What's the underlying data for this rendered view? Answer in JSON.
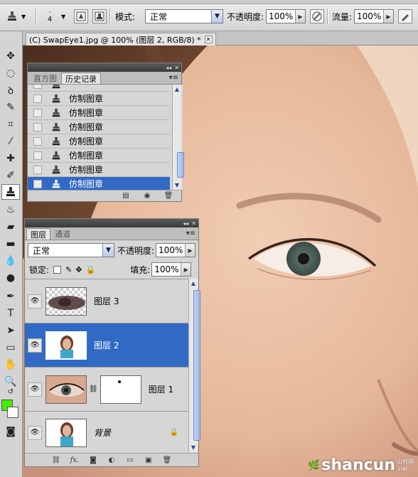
{
  "options_bar": {
    "brush_size": "4",
    "mode_label": "模式:",
    "mode_value": "正常",
    "opacity_label": "不透明度:",
    "opacity_value": "100%",
    "flow_label": "流量:",
    "flow_value": "100%"
  },
  "document": {
    "tab_title": "(C) SwapEye1.jpg @ 100% (图层 2, RGB/8) *"
  },
  "history_panel": {
    "tabs": [
      "直方图",
      "历史记录"
    ],
    "active_tab": "历史记录",
    "items": [
      {
        "label": "仿制图章",
        "selected": false
      },
      {
        "label": "仿制图章",
        "selected": false
      },
      {
        "label": "仿制图章",
        "selected": false
      },
      {
        "label": "仿制图章",
        "selected": false
      },
      {
        "label": "仿制图章",
        "selected": false
      },
      {
        "label": "仿制图章",
        "selected": false
      },
      {
        "label": "仿制图章",
        "selected": true
      }
    ]
  },
  "layers_panel": {
    "tabs": [
      "图层",
      "通道"
    ],
    "active_tab": "图层",
    "blend_mode": "正常",
    "opacity_label": "不透明度:",
    "opacity_value": "100%",
    "lock_label": "锁定:",
    "fill_label": "填充:",
    "fill_value": "100%",
    "layers": [
      {
        "name": "图层 3",
        "selected": false,
        "visible": true
      },
      {
        "name": "图层 2",
        "selected": true,
        "visible": true
      },
      {
        "name": "图层 1",
        "selected": false,
        "visible": true,
        "has_mask": true
      },
      {
        "name": "背景",
        "selected": false,
        "visible": true,
        "locked": true
      }
    ]
  },
  "colors": {
    "foreground": "#44ee00",
    "background": "#ffffff",
    "selection": "#316ac5"
  },
  "watermark": {
    "text": "shancun",
    "sub": "山村网",
    "domain": ".net"
  }
}
